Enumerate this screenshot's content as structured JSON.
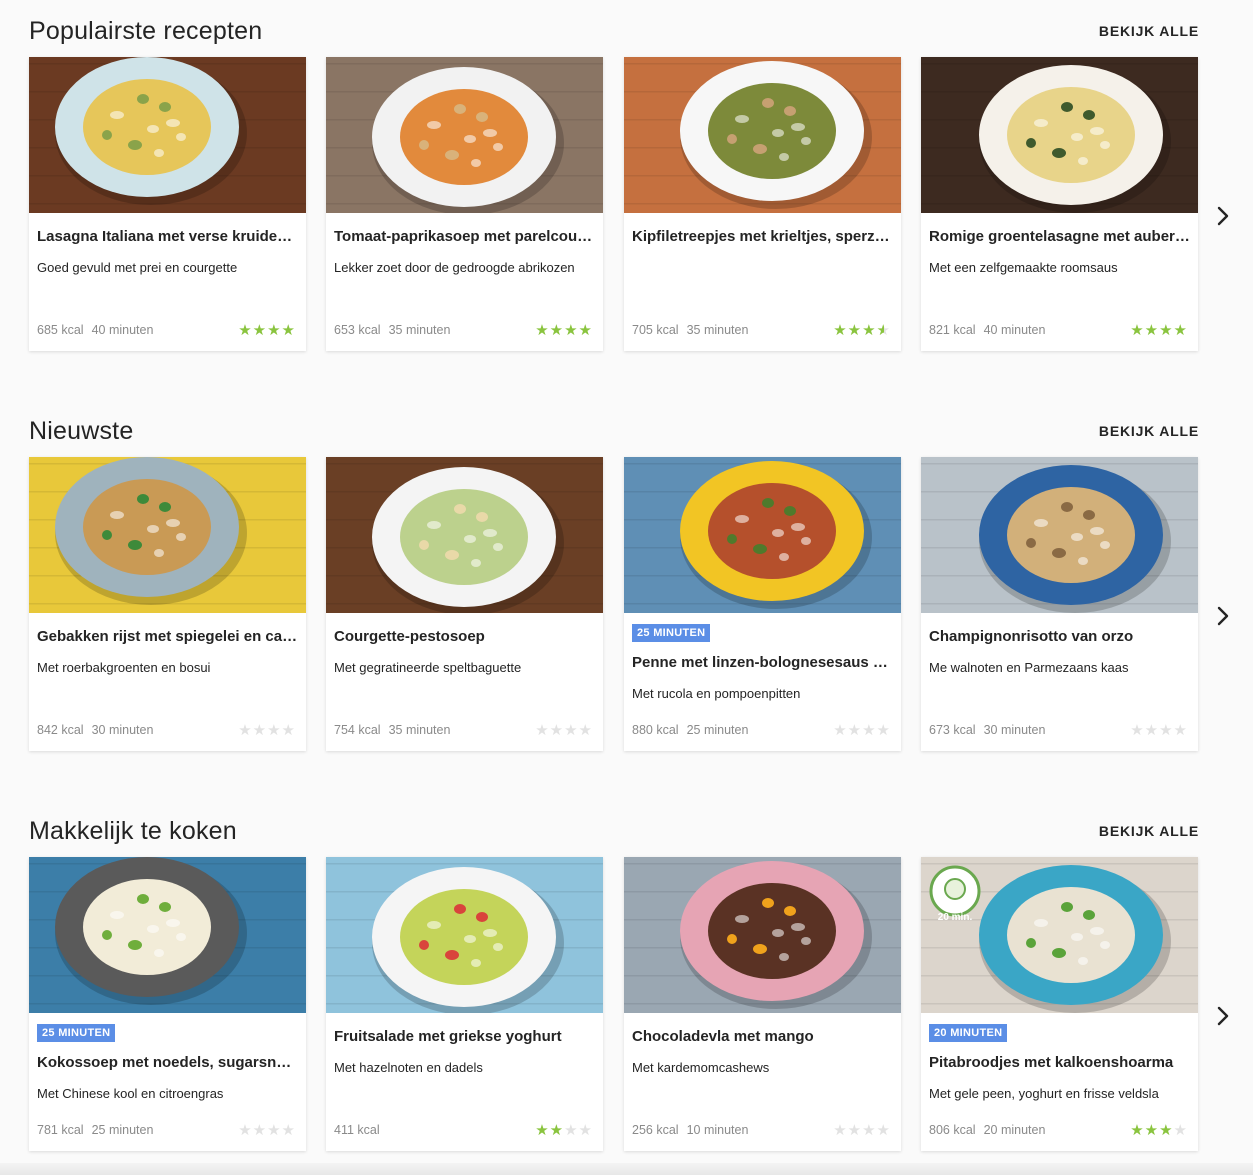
{
  "sections": [
    {
      "title": "Populairste recepten",
      "see_all": "BEKIJK ALLE",
      "cards": [
        {
          "badge": "",
          "title": "Lasagna Italiana met verse kruiden en courgette",
          "subtitle": "Goed gevuld met prei en courgette",
          "kcal": "685 kcal",
          "time": "40 minuten",
          "rating": 4,
          "image_icon": "lasagna-plate-photo",
          "colors": {
            "bg": "#6b3a22",
            "plate": "#cfe3e8",
            "food": "#e6c65a",
            "accent": "#8aa34a"
          }
        },
        {
          "badge": "",
          "title": "Tomaat-paprikasoep met parelcouscous",
          "subtitle": "Lekker zoet door de gedroogde abrikozen",
          "kcal": "653 kcal",
          "time": "35 minuten",
          "rating": 4,
          "image_icon": "tomato-soup-photo",
          "colors": {
            "bg": "#8a7564",
            "plate": "#f2f2f2",
            "food": "#e28a3c",
            "accent": "#d9b27a"
          }
        },
        {
          "badge": "",
          "title": "Kipfiletreepjes met krieltjes, sperziebonen en dragon",
          "subtitle": "",
          "kcal": "705 kcal",
          "time": "35 minuten",
          "rating": 3.5,
          "image_icon": "chicken-potatoes-photo",
          "colors": {
            "bg": "#c5703f",
            "plate": "#f7f7f7",
            "food": "#7d8a3a",
            "accent": "#c6a071"
          }
        },
        {
          "badge": "",
          "title": "Romige groentelasagne met aubergine en spinazie",
          "subtitle": "Met een zelfgemaakte roomsaus",
          "kcal": "821 kcal",
          "time": "40 minuten",
          "rating": 4,
          "image_icon": "vegetable-lasagna-photo",
          "colors": {
            "bg": "#3d2a20",
            "plate": "#f5f1ea",
            "food": "#e8d48a",
            "accent": "#3f5a2d"
          }
        }
      ]
    },
    {
      "title": "Nieuwste",
      "see_all": "BEKIJK ALLE",
      "cards": [
        {
          "badge": "",
          "title": "Gebakken rijst met spiegelei en cashewnoten",
          "subtitle": "Met roerbakgroenten en bosui",
          "kcal": "842 kcal",
          "time": "30 minuten",
          "rating": 0,
          "image_icon": "fried-rice-egg-photo",
          "colors": {
            "bg": "#e8c83a",
            "plate": "#9fb3bd",
            "food": "#c99a55",
            "accent": "#3e8a3a"
          }
        },
        {
          "badge": "",
          "title": "Courgette-pestosoep",
          "subtitle": "Met gegratineerde speltbaguette",
          "kcal": "754 kcal",
          "time": "35 minuten",
          "rating": 0,
          "image_icon": "pesto-soup-photo",
          "colors": {
            "bg": "#6a3f25",
            "plate": "#f4f4f4",
            "food": "#bcd18d",
            "accent": "#e9d9a8"
          }
        },
        {
          "badge": "25 MINUTEN",
          "title": "Penne met linzen-bolognesesaus en feta",
          "subtitle": "Met rucola en pompoenpitten",
          "kcal": "880 kcal",
          "time": "25 minuten",
          "rating": 0,
          "image_icon": "penne-bolognese-photo",
          "colors": {
            "bg": "#5f8fb5",
            "plate": "#f2c524",
            "food": "#b5502c",
            "accent": "#4f7a2c"
          }
        },
        {
          "badge": "",
          "title": "Champignonrisotto van orzo",
          "subtitle": "Me walnoten en Parmezaans kaas",
          "kcal": "673 kcal",
          "time": "30 minuten",
          "rating": 0,
          "image_icon": "orzo-risotto-photo",
          "colors": {
            "bg": "#b9c2c9",
            "plate": "#2e64a3",
            "food": "#d2b07a",
            "accent": "#8a6a44"
          }
        }
      ]
    },
    {
      "title": "Makkelijk te koken",
      "see_all": "BEKIJK ALLE",
      "cards": [
        {
          "badge": "25 MINUTEN",
          "title": "Kokossoep met noedels, sugarsnaps en ei",
          "subtitle": "Met Chinese kool en citroengras",
          "kcal": "781 kcal",
          "time": "25 minuten",
          "rating": 0,
          "image_icon": "coconut-noodle-soup-photo",
          "colors": {
            "bg": "#3c7ea8",
            "plate": "#5a5a5a",
            "food": "#f2ecd8",
            "accent": "#6fae3c"
          }
        },
        {
          "badge": "",
          "title": "Fruitsalade met griekse yoghurt",
          "subtitle": "Met hazelnoten en dadels",
          "kcal": "411 kcal",
          "time": "",
          "rating": 2,
          "image_icon": "fruit-salad-photo",
          "colors": {
            "bg": "#8fc3dc",
            "plate": "#f5f5f5",
            "food": "#c4d45a",
            "accent": "#d9443c"
          }
        },
        {
          "badge": "",
          "title": "Chocoladevla met mango",
          "subtitle": "Met kardemomcashews",
          "kcal": "256 kcal",
          "time": "10 minuten",
          "rating": 0,
          "image_icon": "chocolate-mango-photo",
          "colors": {
            "bg": "#9aa7b2",
            "plate": "#e6a4b4",
            "food": "#5a3224",
            "accent": "#f0a21c"
          }
        },
        {
          "badge": "20 MINUTEN",
          "title": "Pitabroodjes met kalkoenshoarma",
          "subtitle": "Met gele peen, yoghurt en frisse veldsla",
          "kcal": "806 kcal",
          "time": "20 minuten",
          "rating": 3,
          "image_icon": "pita-shawarma-photo",
          "colors": {
            "bg": "#dcd5cc",
            "plate": "#3aa6c6",
            "food": "#e9e2d2",
            "accent": "#5aa33a"
          },
          "stamp": "20 min."
        }
      ]
    }
  ],
  "next_arrow_icon": "chevron-right-icon"
}
